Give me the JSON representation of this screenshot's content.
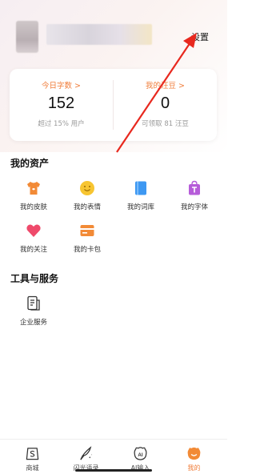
{
  "header": {
    "settings_label": "设置"
  },
  "stats": {
    "words": {
      "title": "今日字数 >",
      "value": "152",
      "sub": "超过 15% 用户"
    },
    "beans": {
      "title": "我的汪豆 >",
      "value": "0",
      "sub": "可领取 81 汪豆"
    }
  },
  "assets": {
    "title": "我的资产",
    "items": [
      {
        "label": "我的皮肤",
        "icon": "tshirt-icon"
      },
      {
        "label": "我的表情",
        "icon": "smiley-icon"
      },
      {
        "label": "我的词库",
        "icon": "book-icon"
      },
      {
        "label": "我的字体",
        "icon": "font-bag-icon"
      },
      {
        "label": "我的关注",
        "icon": "heart-icon"
      },
      {
        "label": "我的卡包",
        "icon": "card-icon"
      }
    ]
  },
  "tools": {
    "title": "工具与服务",
    "items": [
      {
        "label": "企业服务",
        "icon": "document-icon"
      }
    ]
  },
  "nav": {
    "items": [
      {
        "label": "商城",
        "icon": "shop-icon"
      },
      {
        "label": "闪光语录",
        "icon": "quill-icon"
      },
      {
        "label": "AI输入",
        "icon": "ai-icon"
      },
      {
        "label": "我的",
        "icon": "profile-icon",
        "active": true
      }
    ]
  },
  "colors": {
    "accent": "#f07d3a",
    "annotation": "#e8281e"
  }
}
